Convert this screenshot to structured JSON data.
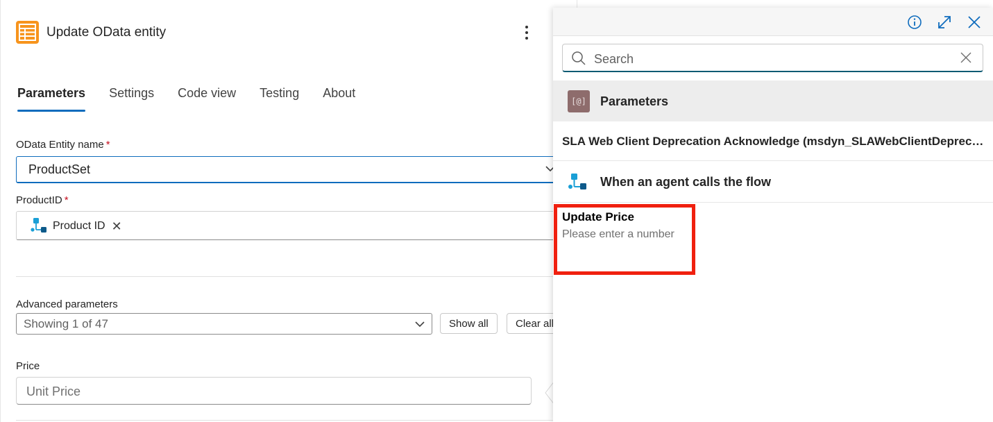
{
  "header": {
    "title": "Update OData entity",
    "icon": "table-icon",
    "icon_color": "#f7941d"
  },
  "tabs": [
    {
      "label": "Parameters",
      "active": true
    },
    {
      "label": "Settings",
      "active": false
    },
    {
      "label": "Code view",
      "active": false
    },
    {
      "label": "Testing",
      "active": false
    },
    {
      "label": "About",
      "active": false
    }
  ],
  "fields": {
    "entity_name": {
      "label": "OData Entity name",
      "required_mark": "*",
      "value": "ProductSet"
    },
    "product_id": {
      "label": "ProductID",
      "required_mark": "*",
      "token": "Product ID",
      "token_remove": "✕"
    },
    "advanced": {
      "label": "Advanced parameters",
      "value": "Showing 1 of 47",
      "show_all": "Show all",
      "clear_all": "Clear all"
    },
    "price": {
      "label": "Price",
      "placeholder": "Unit Price"
    }
  },
  "flyout": {
    "search": {
      "placeholder": "Search"
    },
    "section_badge": "[@]",
    "section_title": "Parameters",
    "items": [
      {
        "label": "SLA Web Client Deprecation Acknowledge (msdyn_SLAWebClientDeprecationAcknowledge)"
      },
      {
        "label": "When an agent calls the flow"
      }
    ],
    "highlighted": {
      "title": "Update Price",
      "description": "Please enter a number"
    }
  },
  "colors": {
    "accent": "#0f6cbd",
    "highlight_box": "#f0200f",
    "badge": "#8e6c6c",
    "trigger_icon": "#1a9fd6"
  }
}
